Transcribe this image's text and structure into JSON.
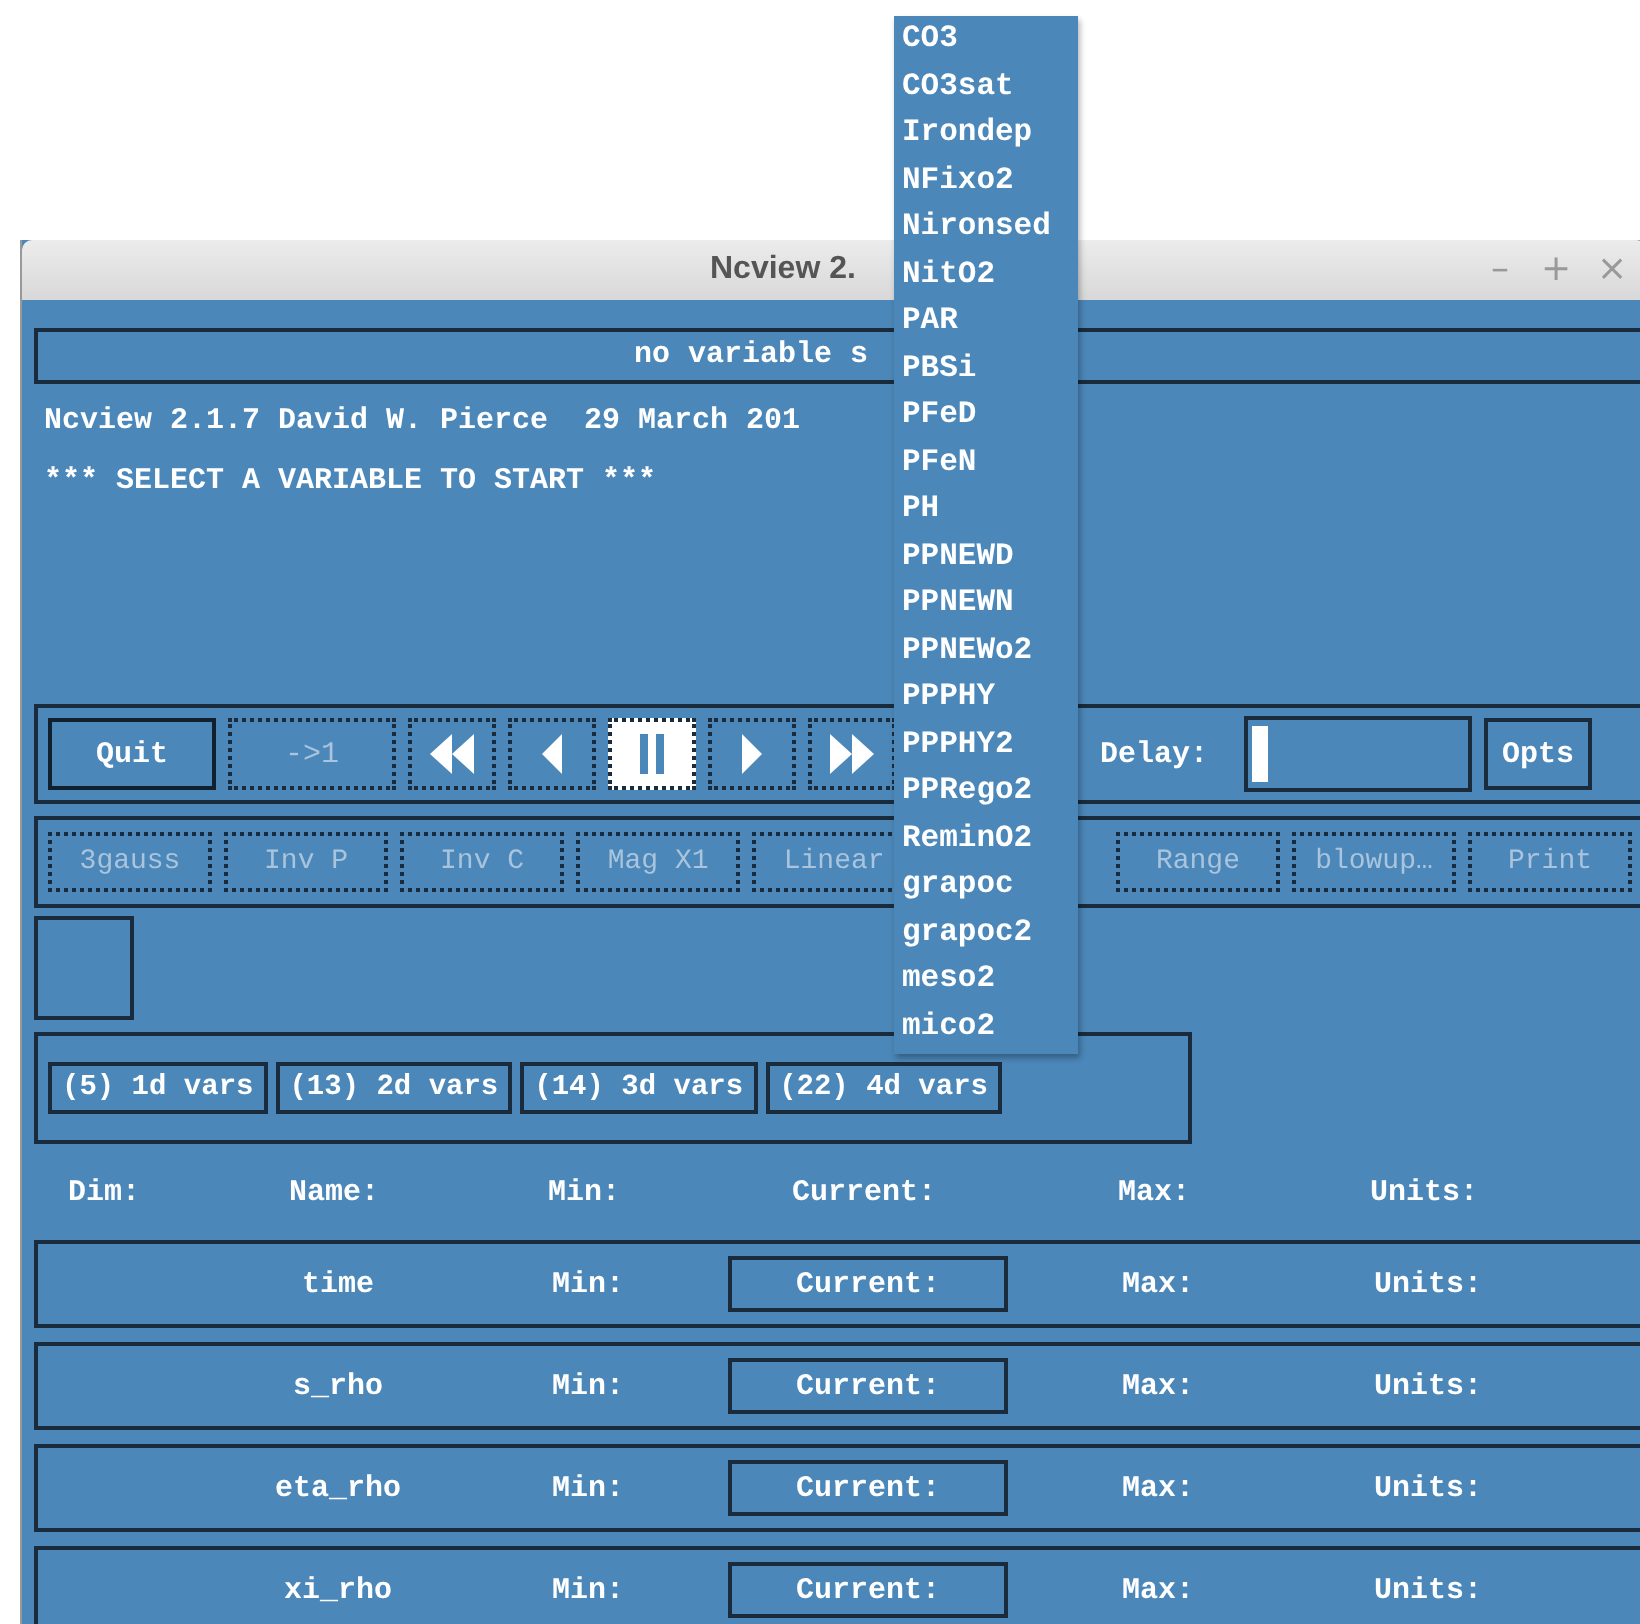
{
  "window": {
    "title": "Ncview 2.",
    "controls": [
      "–",
      "+",
      "×"
    ]
  },
  "status": "no variable s",
  "info_lines": [
    "Ncview 2.1.7 David W. Pierce  29 March 201",
    "*** SELECT A VARIABLE TO START ***"
  ],
  "playback": [
    {
      "kind": "text",
      "label": "Quit",
      "disabled": false,
      "selected": false
    },
    {
      "kind": "text",
      "label": "->1",
      "disabled": true,
      "selected": false
    },
    {
      "kind": "rewind",
      "selected": false
    },
    {
      "kind": "back",
      "selected": false
    },
    {
      "kind": "pause",
      "selected": true
    },
    {
      "kind": "forward",
      "selected": false
    },
    {
      "kind": "fastforward",
      "selected": false
    }
  ],
  "delay": {
    "label": "Delay:"
  },
  "opts_button": "Opts",
  "options": [
    {
      "label": "3gauss",
      "disabled": true
    },
    {
      "label": "Inv P",
      "disabled": true
    },
    {
      "label": "Inv C",
      "disabled": true
    },
    {
      "label": "Mag X1",
      "disabled": true
    },
    {
      "label": "Linear",
      "disabled": true
    },
    {
      "label": "Range",
      "disabled": true
    },
    {
      "label": "blowup…",
      "disabled": true
    },
    {
      "label": "Print",
      "disabled": true
    }
  ],
  "var_groups": [
    {
      "label": "(5) 1d vars"
    },
    {
      "label": "(13) 2d vars"
    },
    {
      "label": "(14) 3d vars"
    },
    {
      "label": "(22) 4d vars"
    }
  ],
  "dims_header": [
    "Dim:",
    "Name:",
    "Min:",
    "Current:",
    "Max:",
    "Units:"
  ],
  "dims": [
    {
      "name": "time",
      "min": "Min:",
      "current": "Current:",
      "max": "Max:",
      "units": "Units:"
    },
    {
      "name": "s_rho",
      "min": "Min:",
      "current": "Current:",
      "max": "Max:",
      "units": "Units:"
    },
    {
      "name": "eta_rho",
      "min": "Min:",
      "current": "Current:",
      "max": "Max:",
      "units": "Units:"
    },
    {
      "name": "xi_rho",
      "min": "Min:",
      "current": "Current:",
      "max": "Max:",
      "units": "Units:"
    }
  ],
  "variable_menu": [
    "CO3",
    "CO3sat",
    "Irondep",
    "NFixo2",
    "Nironsed",
    "NitO2",
    "PAR",
    "PBSi",
    "PFeD",
    "PFeN",
    "PH",
    "PPNEWD",
    "PPNEWN",
    "PPNEWo2",
    "PPPHY",
    "PPPHY2",
    "PPRego2",
    "ReminO2",
    "grapoc",
    "grapoc2",
    "meso2",
    "mico2"
  ]
}
